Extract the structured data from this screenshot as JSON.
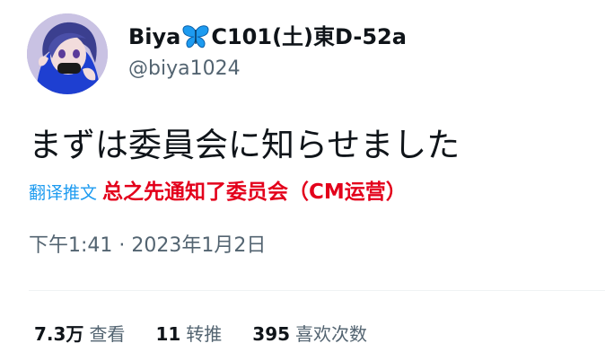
{
  "author": {
    "name_prefix": "Biya",
    "name_suffix": "C101(土)東D-52a",
    "handle": "@biya1024",
    "avatar_icon": "anime-girl-avatar",
    "name_emoji_icon": "butterfly-emoji"
  },
  "tweet": {
    "text": "まずは委員会に知らせました",
    "translate_label": "翻译推文",
    "translation": "总之先通知了委员会（CM运营）",
    "timestamp": "下午1:41 · 2023年1月2日"
  },
  "stats": {
    "views_value": "7.3万",
    "views_label": "查看",
    "retweets_value": "11",
    "retweets_label": "转推",
    "likes_value": "395",
    "likes_label": "喜欢次数"
  },
  "colors": {
    "link": "#1d9bf0",
    "translation_red": "#e3001b",
    "secondary_text": "#536471",
    "butterfly": "#1d9bf0"
  }
}
